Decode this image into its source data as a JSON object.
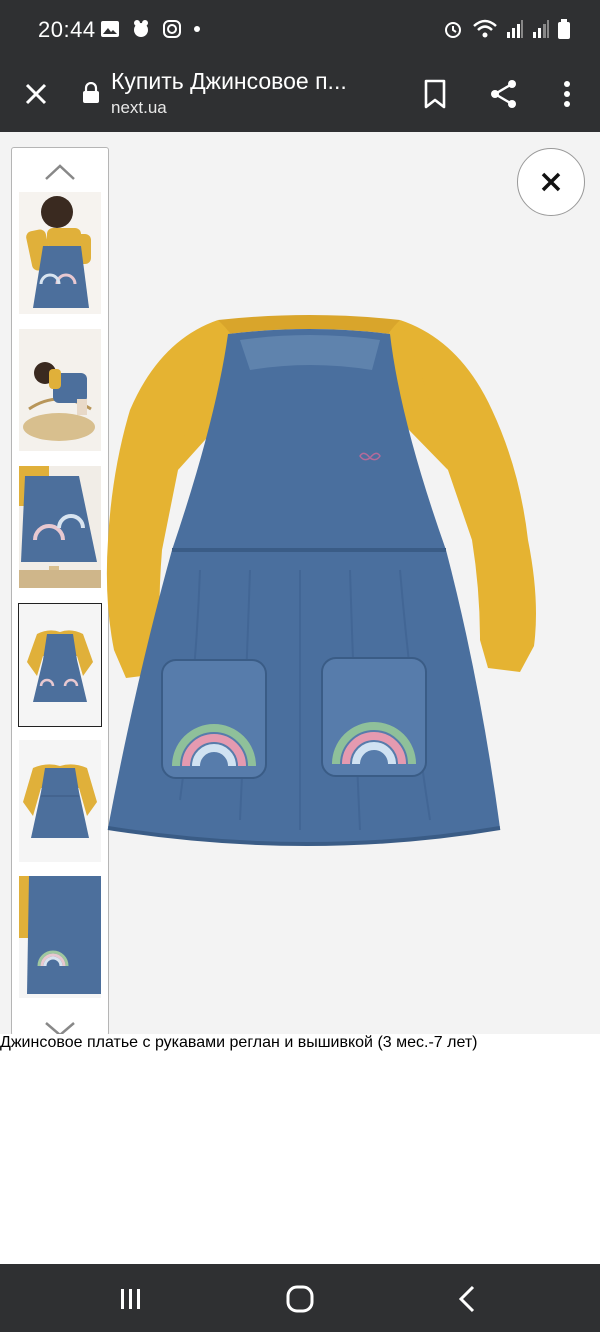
{
  "status_bar": {
    "time": "20:44"
  },
  "browser": {
    "page_title": "Купить Джинсовое п...",
    "host": "next.ua"
  },
  "product": {
    "title": "Джинсовое платье с рукавами реглан и вышивкой (3 мес.-7 лет)"
  },
  "gallery": {
    "thumbnails": [
      "Фото 1",
      "Фото 2",
      "Фото 3",
      "Фото 4",
      "Фото 5",
      "Фото 6"
    ],
    "selected_index": 3
  },
  "colors": {
    "chrome": "#2f3032",
    "denim": "#4a6f9e",
    "mustard": "#e5b332"
  }
}
